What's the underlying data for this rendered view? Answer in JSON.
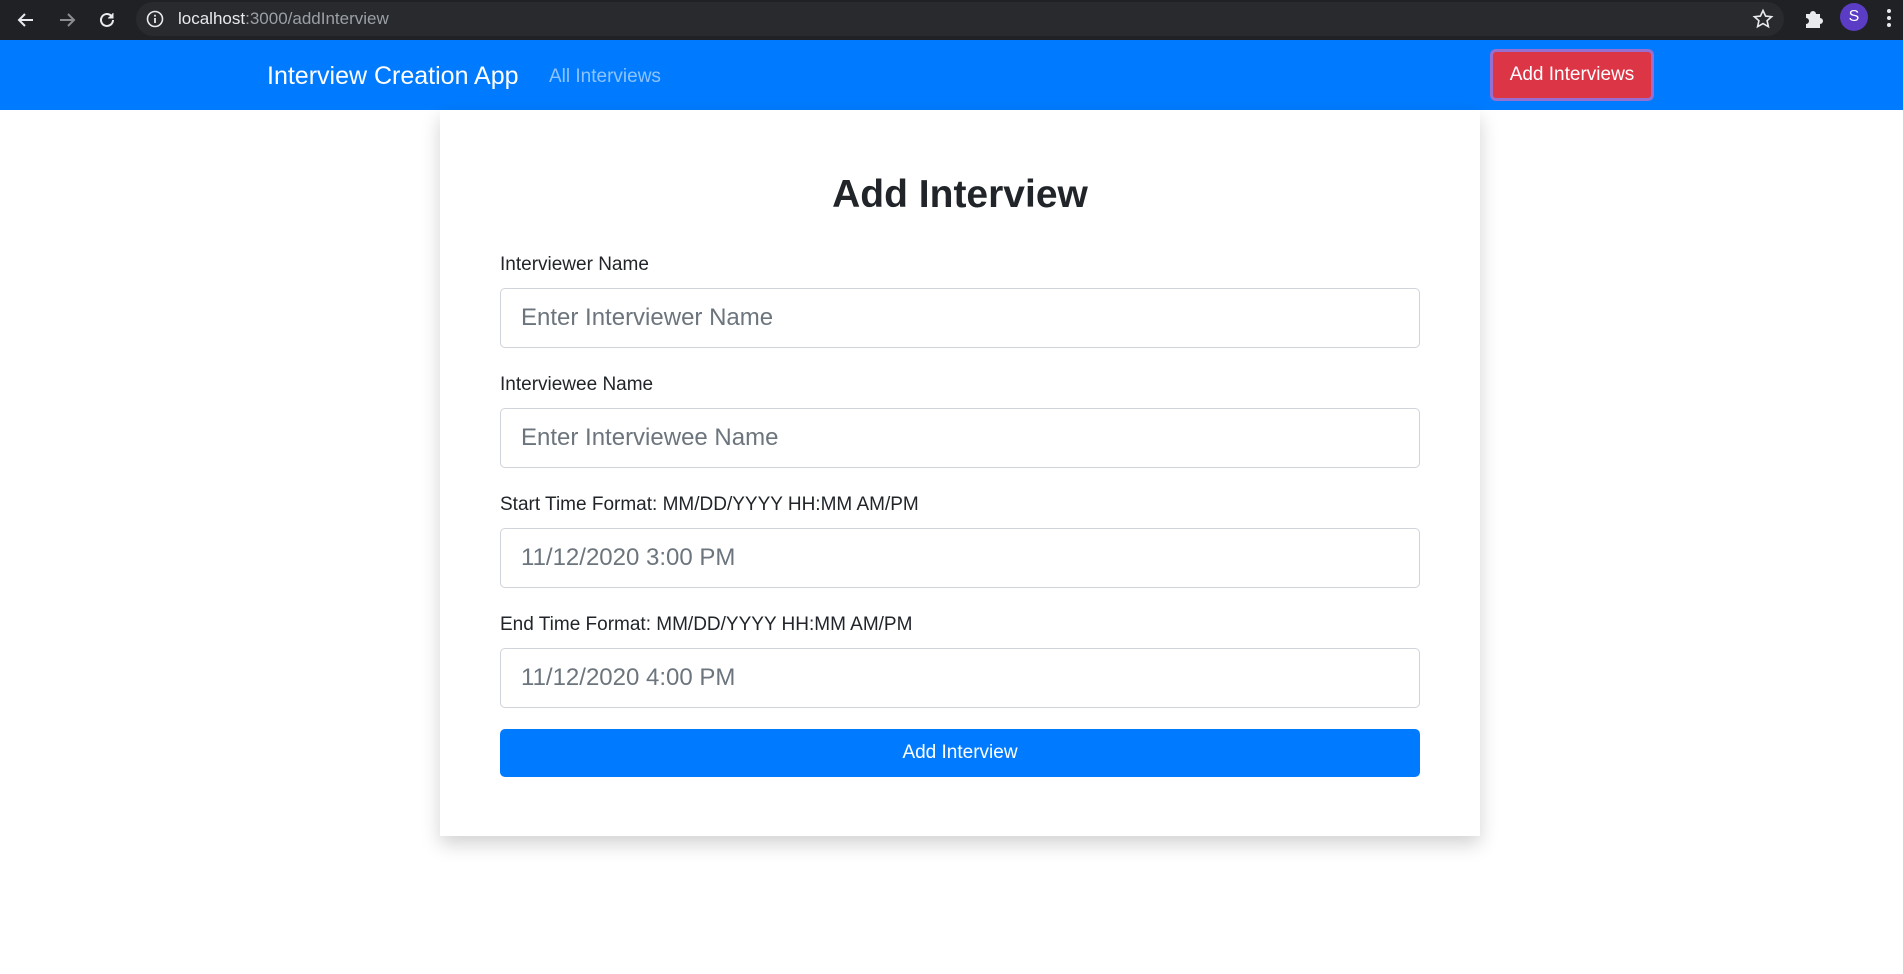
{
  "browser": {
    "url_host": "localhost",
    "url_path": ":3000/addInterview",
    "profile_initial": "S",
    "icons": [
      "back-icon",
      "forward-icon",
      "reload-icon",
      "info-icon",
      "star-icon",
      "extensions-icon",
      "menu-icon"
    ]
  },
  "navbar": {
    "brand": "Interview Creation App",
    "link_all": "All Interviews",
    "add_button": "Add Interviews",
    "colors": {
      "bar": "#007bff",
      "button": "#dc3545"
    }
  },
  "form": {
    "title": "Add Interview",
    "fields": [
      {
        "label": "Interviewer Name",
        "placeholder": "Enter Interviewer Name"
      },
      {
        "label": "Interviewee Name",
        "placeholder": "Enter Interviewee Name"
      },
      {
        "label": "Start Time Format: MM/DD/YYYY HH:MM AM/PM",
        "placeholder": "11/12/2020 3:00 PM"
      },
      {
        "label": "End Time Format: MM/DD/YYYY HH:MM AM/PM",
        "placeholder": "11/12/2020 4:00 PM"
      }
    ],
    "submit": "Add Interview"
  }
}
